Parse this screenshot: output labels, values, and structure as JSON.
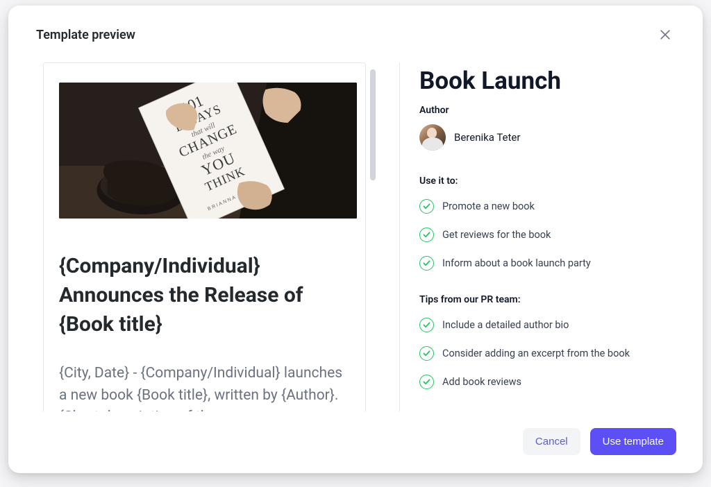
{
  "header": {
    "title": "Template preview"
  },
  "document": {
    "headline": "{Company/Individual} Announces the Release of {Book title}",
    "body": "{City, Date} - {Company/Individual} launches a new book {Book title}, written by {Author}. {Short description of the",
    "book_cover": {
      "line1": "101",
      "line2": "ESSAYS",
      "line3": "that will",
      "line4": "CHANGE",
      "line5": "the way",
      "line6": "YOU",
      "line7": "THINK",
      "author": "BRIANNA WIEST"
    }
  },
  "meta": {
    "title": "Book Launch",
    "author_label": "Author",
    "author_name": "Berenika Teter"
  },
  "use_it": {
    "label": "Use it to:",
    "items": [
      "Promote a new book",
      "Get reviews for the book",
      "Inform about a book launch party"
    ]
  },
  "tips": {
    "label": "Tips from our PR team:",
    "items": [
      "Include a detailed author bio",
      "Consider adding an excerpt from the book",
      "Add book reviews"
    ]
  },
  "footer": {
    "cancel": "Cancel",
    "use_template": "Use template"
  }
}
